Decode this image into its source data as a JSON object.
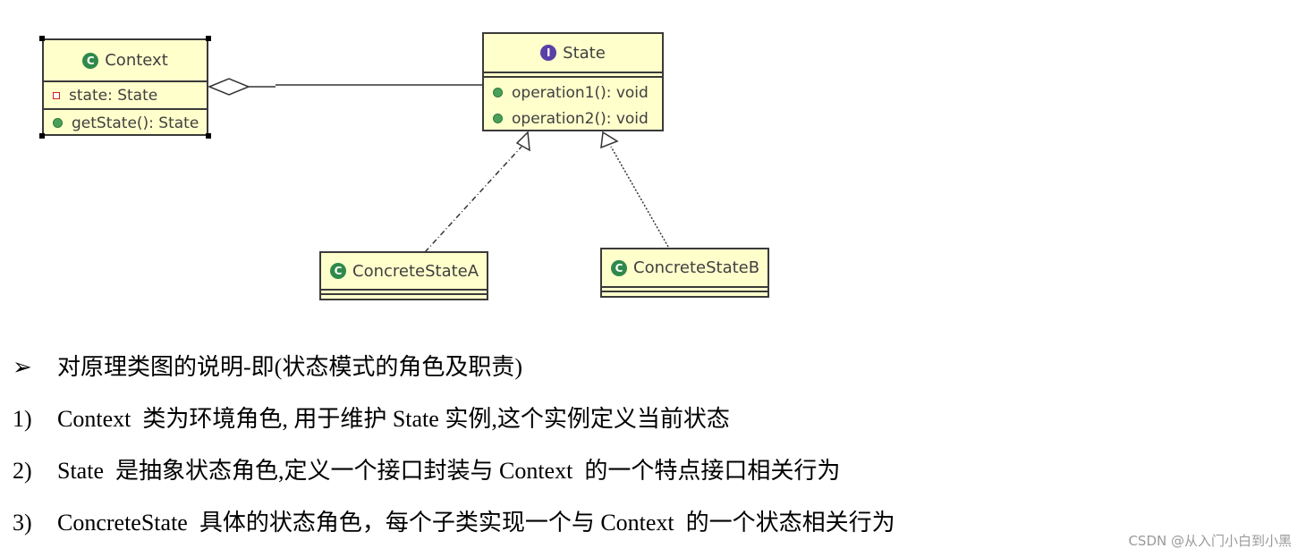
{
  "diagram": {
    "context": {
      "name": "Context",
      "badge": "C",
      "attribute": "state: State",
      "method": "getState(): State"
    },
    "state": {
      "name": "State",
      "badge": "I",
      "methods": [
        "operation1(): void",
        "operation2(): void"
      ]
    },
    "concrete_a": {
      "name": "ConcreteStateA",
      "badge": "C"
    },
    "concrete_b": {
      "name": "ConcreteStateB",
      "badge": "C"
    },
    "relations": [
      {
        "from": "Context",
        "to": "State",
        "type": "aggregation"
      },
      {
        "from": "ConcreteStateA",
        "to": "State",
        "type": "realization"
      },
      {
        "from": "ConcreteStateB",
        "to": "State",
        "type": "realization"
      }
    ],
    "colors": {
      "box_fill": "#ffffcc",
      "class_badge": "#2f8a4a",
      "interface_badge": "#5a3fa8",
      "private_marker": "#cc2222",
      "public_marker": "#4aa05a"
    }
  },
  "notes": {
    "heading_bullet": "➢",
    "heading": "对原理类图的说明-即(状态模式的角色及职责)",
    "items": [
      {
        "num": "1)",
        "text": "Context  类为环境角色, 用于维护 State 实例,这个实例定义当前状态"
      },
      {
        "num": "2)",
        "text": "State  是抽象状态角色,定义一个接口封装与 Context  的一个特点接口相关行为"
      },
      {
        "num": "3)",
        "text": "ConcreteState  具体的状态角色，每个子类实现一个与 Context  的一个状态相关行为"
      }
    ]
  },
  "watermark": "CSDN @从入门小白到小黑"
}
